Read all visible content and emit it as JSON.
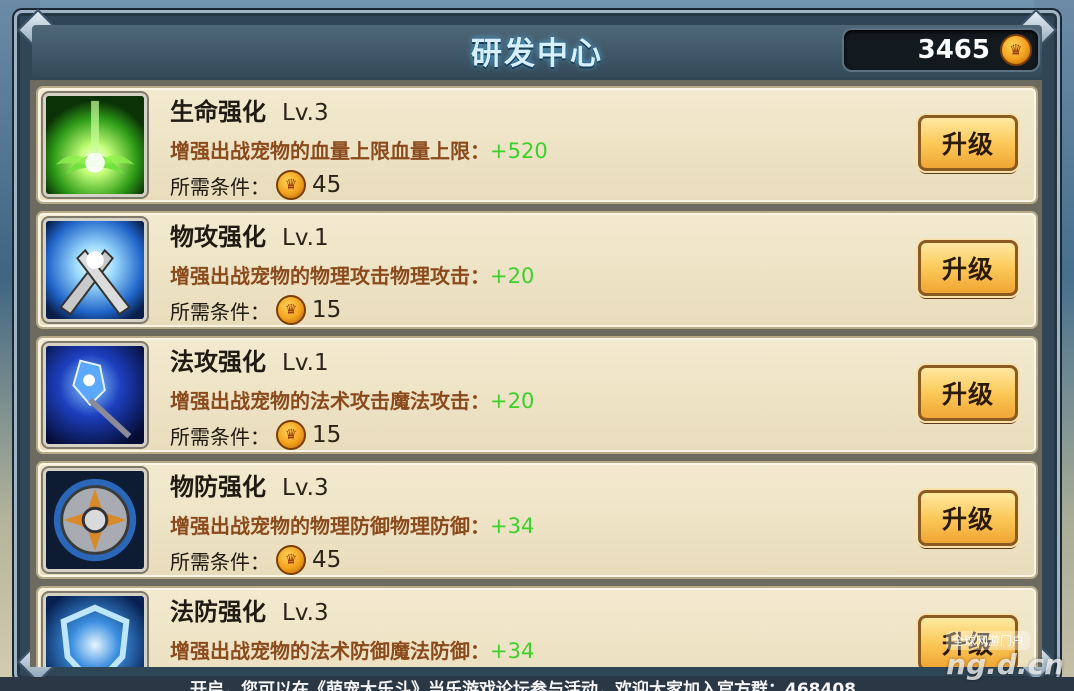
{
  "header": {
    "title": "研发中心",
    "coins": "3465"
  },
  "coin_symbol": "♛",
  "items": [
    {
      "name": "生命强化",
      "level": "Lv.3",
      "desc": "增强出战宠物的血量上限血量上限：",
      "bonus": "+520",
      "req_label": "所需条件：",
      "req_value": "45",
      "button": "升级",
      "icon": "life-boost-icon"
    },
    {
      "name": "物攻强化",
      "level": "Lv.1",
      "desc": "增强出战宠物的物理攻击物理攻击：",
      "bonus": "+20",
      "req_label": "所需条件：",
      "req_value": "15",
      "button": "升级",
      "icon": "physical-attack-icon"
    },
    {
      "name": "法攻强化",
      "level": "Lv.1",
      "desc": "增强出战宠物的法术攻击魔法攻击：",
      "bonus": "+20",
      "req_label": "所需条件：",
      "req_value": "15",
      "button": "升级",
      "icon": "magic-attack-icon"
    },
    {
      "name": "物防强化",
      "level": "Lv.3",
      "desc": "增强出战宠物的物理防御物理防御：",
      "bonus": "+34",
      "req_label": "所需条件：",
      "req_value": "45",
      "button": "升级",
      "icon": "physical-defense-icon"
    },
    {
      "name": "法防强化",
      "level": "Lv.3",
      "desc": "增强出战宠物的法术防御魔法防御：",
      "bonus": "+34",
      "req_label": "",
      "req_value": "",
      "button": "升级",
      "icon": "magic-defense-icon"
    }
  ],
  "ticker": "开启，您可以在《萌宠大乐斗》当乐游戏论坛参与活动，欢迎大家加入官方群：468408",
  "watermark": {
    "top": "全球网游门户",
    "main": "ng.d.cn"
  },
  "colors": {
    "bonus": "#3bd12a",
    "desc": "#8a4a1c",
    "button": "#fbc958",
    "title": "#d7f0ff"
  }
}
